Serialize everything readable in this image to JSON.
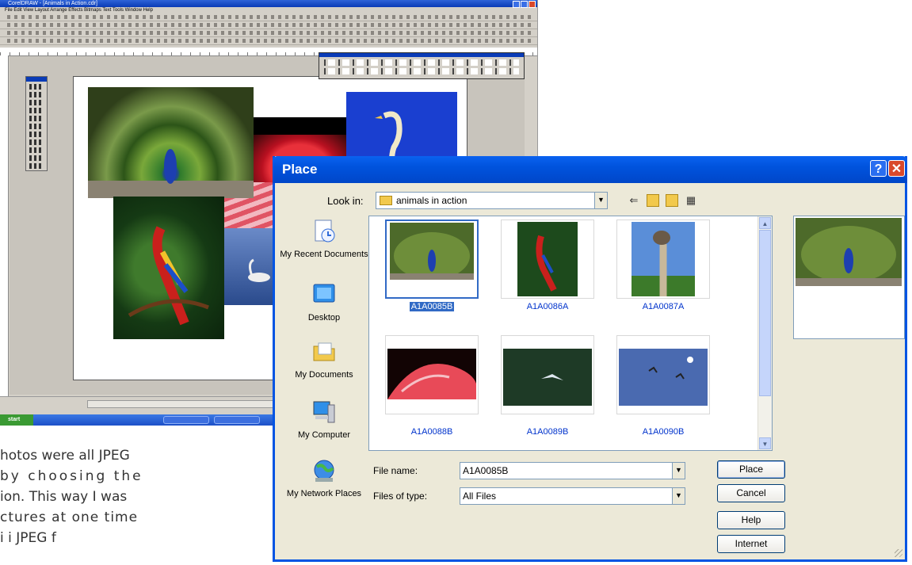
{
  "background_app": {
    "title": "CorelDRAW - [Animals in Action.cdr]",
    "menu": "File  Edit  View  Layout  Arrange  Effects  Bitmaps  Text  Tools  Window  Help",
    "taskbar_start": "start"
  },
  "caption": {
    "lines": [
      "hotos were all JPEG",
      "by choosing the",
      "ion. This way I was",
      "ctures at one time",
      "i       i   JPEG   f"
    ]
  },
  "dialog": {
    "title": "Place",
    "help_button": "?",
    "close_button": "✕",
    "look_in_label": "Look in:",
    "look_in_value": "animals in action",
    "nav": [
      "back-icon",
      "up-folder-icon",
      "new-folder-icon",
      "views-menu-icon"
    ],
    "places": [
      {
        "label": "My Recent Documents",
        "icon": "recent-documents-icon"
      },
      {
        "label": "Desktop",
        "icon": "desktop-icon"
      },
      {
        "label": "My Documents",
        "icon": "my-documents-icon"
      },
      {
        "label": "My Computer",
        "icon": "my-computer-icon"
      },
      {
        "label": "My Network Places",
        "icon": "network-places-icon"
      }
    ],
    "files": [
      {
        "name": "A1A0085B",
        "selected": true
      },
      {
        "name": "A1A0086A",
        "selected": false
      },
      {
        "name": "A1A0087A",
        "selected": false
      },
      {
        "name": "A1A0088B",
        "selected": false
      },
      {
        "name": "A1A0089B",
        "selected": false
      },
      {
        "name": "A1A0090B",
        "selected": false
      }
    ],
    "file_name_label": "File name:",
    "file_name_value": "A1A0085B",
    "file_type_label": "Files of type:",
    "file_type_value": "All Files",
    "buttons": {
      "place": "Place",
      "cancel": "Cancel",
      "help": "Help",
      "internet": "Internet"
    },
    "colors": {
      "titlebar": "#0054e3",
      "dialog_bg": "#ece9d8",
      "selection": "#316ac5",
      "link_text": "#0033cc"
    }
  }
}
